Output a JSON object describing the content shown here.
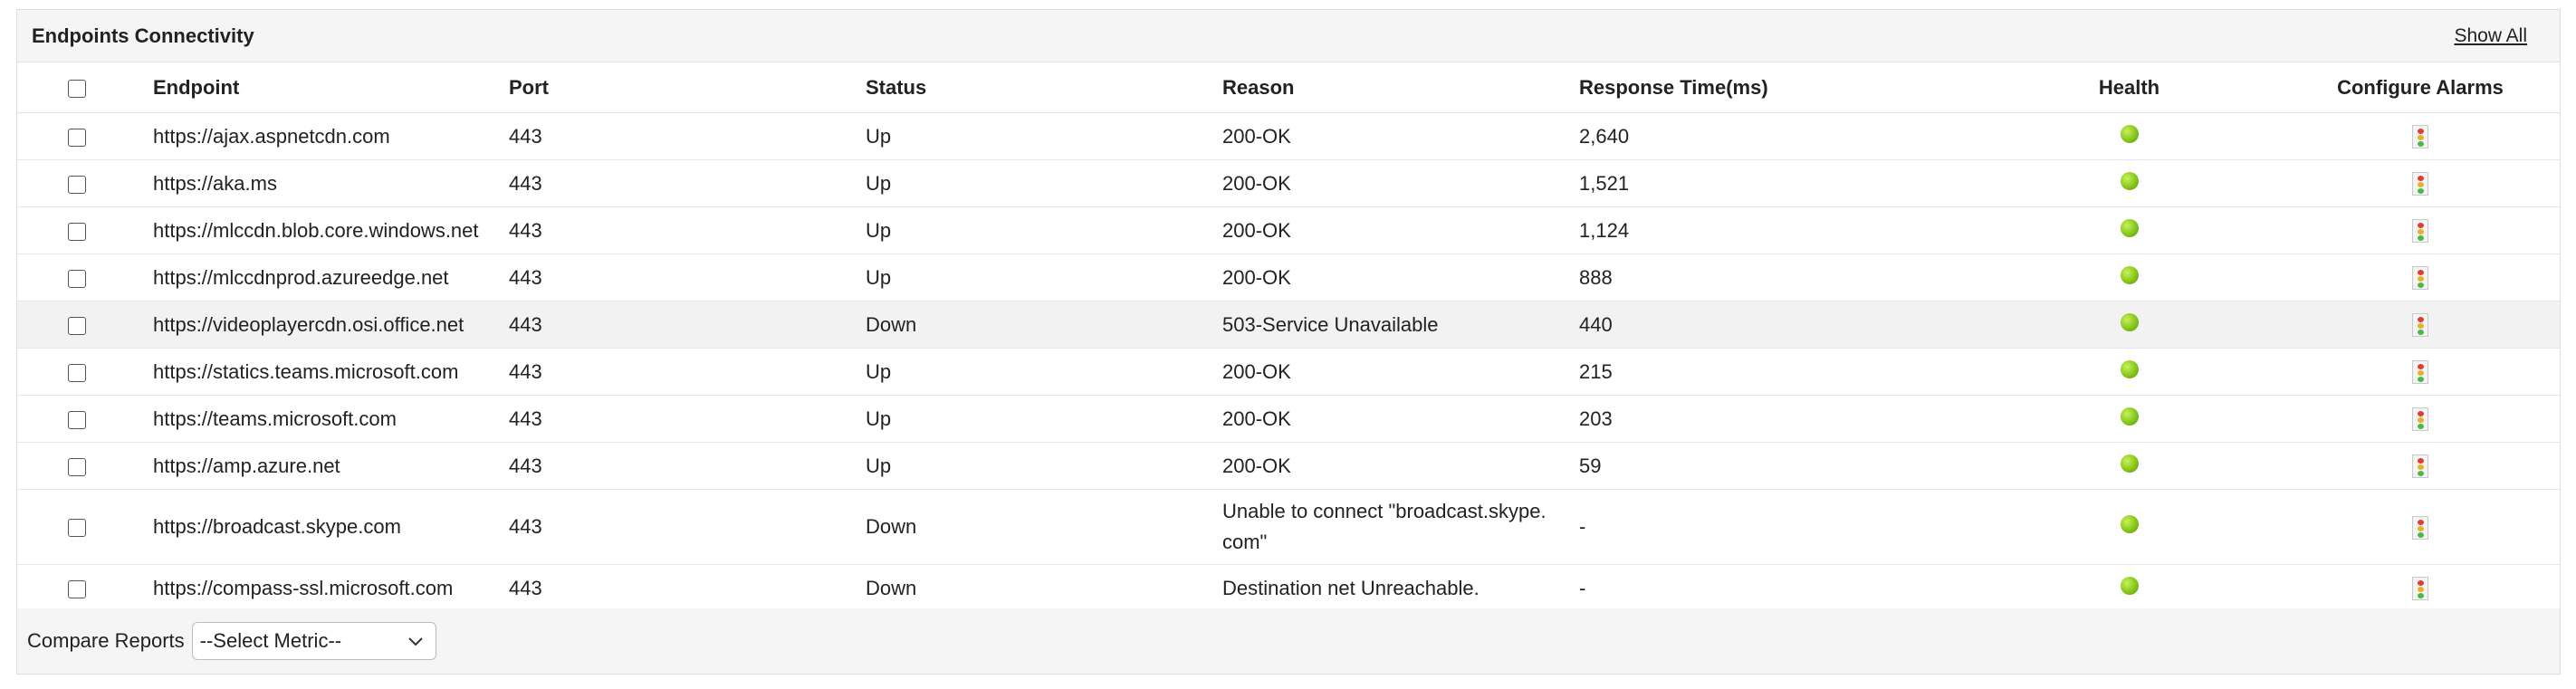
{
  "panel": {
    "title": "Endpoints Connectivity",
    "show_all_label": "Show All"
  },
  "table": {
    "headers": {
      "endpoint": "Endpoint",
      "port": "Port",
      "status": "Status",
      "reason": "Reason",
      "response_time": "Response Time(ms)",
      "health": "Health",
      "configure_alarms": "Configure Alarms"
    },
    "rows": [
      {
        "endpoint": "https://ajax.aspnetcdn.com",
        "port": "443",
        "status": "Up",
        "reason": "200-OK",
        "response_time": "2,640",
        "health": "green-dot-icon",
        "alarm": "traffic-light-icon"
      },
      {
        "endpoint": "https://aka.ms",
        "port": "443",
        "status": "Up",
        "reason": "200-OK",
        "response_time": "1,521",
        "health": "green-dot-icon",
        "alarm": "traffic-light-icon"
      },
      {
        "endpoint": "https://mlccdn.blob.core.windows.net",
        "port": "443",
        "status": "Up",
        "reason": "200-OK",
        "response_time": "1,124",
        "health": "green-dot-icon",
        "alarm": "traffic-light-icon"
      },
      {
        "endpoint": "https://mlccdnprod.azureedge.net",
        "port": "443",
        "status": "Up",
        "reason": "200-OK",
        "response_time": "888",
        "health": "green-dot-icon",
        "alarm": "traffic-light-icon"
      },
      {
        "endpoint": "https://videoplayercdn.osi.office.net",
        "port": "443",
        "status": "Down",
        "reason": "503-Service Unavailable",
        "response_time": "440",
        "health": "green-dot-icon",
        "alarm": "traffic-light-icon"
      },
      {
        "endpoint": "https://statics.teams.microsoft.com",
        "port": "443",
        "status": "Up",
        "reason": "200-OK",
        "response_time": "215",
        "health": "green-dot-icon",
        "alarm": "traffic-light-icon"
      },
      {
        "endpoint": "https://teams.microsoft.com",
        "port": "443",
        "status": "Up",
        "reason": "200-OK",
        "response_time": "203",
        "health": "green-dot-icon",
        "alarm": "traffic-light-icon"
      },
      {
        "endpoint": "https://amp.azure.net",
        "port": "443",
        "status": "Up",
        "reason": "200-OK",
        "response_time": "59",
        "health": "green-dot-icon",
        "alarm": "traffic-light-icon"
      },
      {
        "endpoint": "https://broadcast.skype.com",
        "port": "443",
        "status": "Down",
        "reason": "Unable to connect \"broadcast.skype.com\"",
        "response_time": "-",
        "health": "green-dot-icon",
        "alarm": "traffic-light-icon"
      },
      {
        "endpoint": "https://compass-ssl.microsoft.com",
        "port": "443",
        "status": "Down",
        "reason": "Destination net Unreachable.",
        "response_time": "-",
        "health": "green-dot-icon",
        "alarm": "traffic-light-icon"
      }
    ]
  },
  "footer": {
    "compare_label": "Compare Reports",
    "metric_select": "--Select Metric--"
  },
  "colors": {
    "health_ok": "#86c51a",
    "header_bg": "#f5f5f5",
    "highlight_row_bg": "#f2f2f2"
  }
}
